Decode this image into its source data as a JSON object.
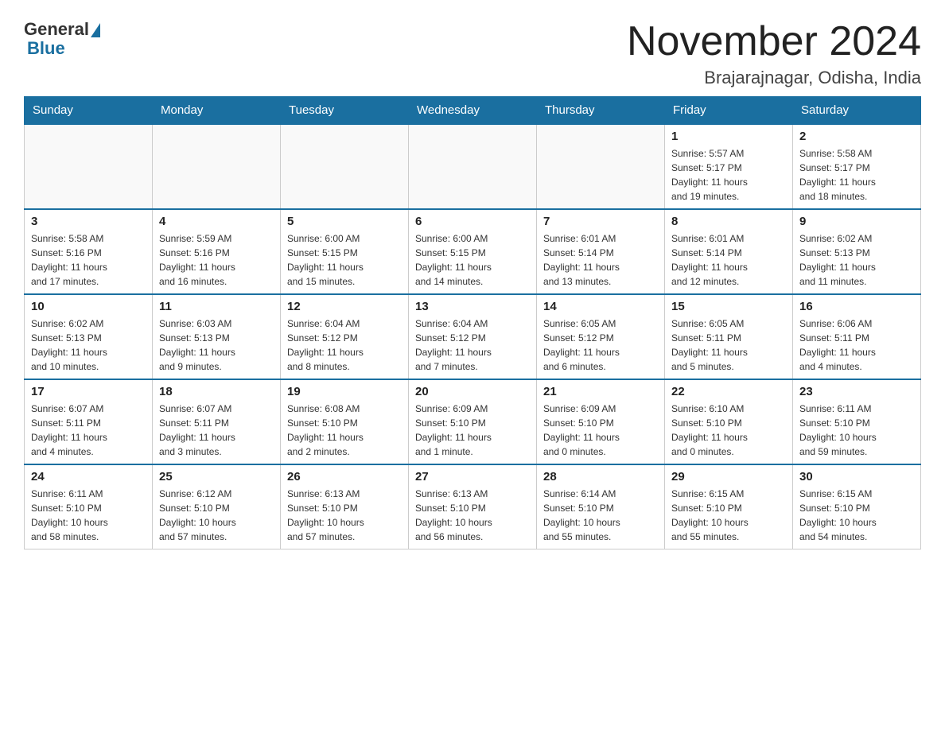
{
  "logo": {
    "general": "General",
    "blue": "Blue"
  },
  "title": "November 2024",
  "location": "Brajarajnagar, Odisha, India",
  "weekdays": [
    "Sunday",
    "Monday",
    "Tuesday",
    "Wednesday",
    "Thursday",
    "Friday",
    "Saturday"
  ],
  "weeks": [
    [
      {
        "day": "",
        "info": ""
      },
      {
        "day": "",
        "info": ""
      },
      {
        "day": "",
        "info": ""
      },
      {
        "day": "",
        "info": ""
      },
      {
        "day": "",
        "info": ""
      },
      {
        "day": "1",
        "info": "Sunrise: 5:57 AM\nSunset: 5:17 PM\nDaylight: 11 hours\nand 19 minutes."
      },
      {
        "day": "2",
        "info": "Sunrise: 5:58 AM\nSunset: 5:17 PM\nDaylight: 11 hours\nand 18 minutes."
      }
    ],
    [
      {
        "day": "3",
        "info": "Sunrise: 5:58 AM\nSunset: 5:16 PM\nDaylight: 11 hours\nand 17 minutes."
      },
      {
        "day": "4",
        "info": "Sunrise: 5:59 AM\nSunset: 5:16 PM\nDaylight: 11 hours\nand 16 minutes."
      },
      {
        "day": "5",
        "info": "Sunrise: 6:00 AM\nSunset: 5:15 PM\nDaylight: 11 hours\nand 15 minutes."
      },
      {
        "day": "6",
        "info": "Sunrise: 6:00 AM\nSunset: 5:15 PM\nDaylight: 11 hours\nand 14 minutes."
      },
      {
        "day": "7",
        "info": "Sunrise: 6:01 AM\nSunset: 5:14 PM\nDaylight: 11 hours\nand 13 minutes."
      },
      {
        "day": "8",
        "info": "Sunrise: 6:01 AM\nSunset: 5:14 PM\nDaylight: 11 hours\nand 12 minutes."
      },
      {
        "day": "9",
        "info": "Sunrise: 6:02 AM\nSunset: 5:13 PM\nDaylight: 11 hours\nand 11 minutes."
      }
    ],
    [
      {
        "day": "10",
        "info": "Sunrise: 6:02 AM\nSunset: 5:13 PM\nDaylight: 11 hours\nand 10 minutes."
      },
      {
        "day": "11",
        "info": "Sunrise: 6:03 AM\nSunset: 5:13 PM\nDaylight: 11 hours\nand 9 minutes."
      },
      {
        "day": "12",
        "info": "Sunrise: 6:04 AM\nSunset: 5:12 PM\nDaylight: 11 hours\nand 8 minutes."
      },
      {
        "day": "13",
        "info": "Sunrise: 6:04 AM\nSunset: 5:12 PM\nDaylight: 11 hours\nand 7 minutes."
      },
      {
        "day": "14",
        "info": "Sunrise: 6:05 AM\nSunset: 5:12 PM\nDaylight: 11 hours\nand 6 minutes."
      },
      {
        "day": "15",
        "info": "Sunrise: 6:05 AM\nSunset: 5:11 PM\nDaylight: 11 hours\nand 5 minutes."
      },
      {
        "day": "16",
        "info": "Sunrise: 6:06 AM\nSunset: 5:11 PM\nDaylight: 11 hours\nand 4 minutes."
      }
    ],
    [
      {
        "day": "17",
        "info": "Sunrise: 6:07 AM\nSunset: 5:11 PM\nDaylight: 11 hours\nand 4 minutes."
      },
      {
        "day": "18",
        "info": "Sunrise: 6:07 AM\nSunset: 5:11 PM\nDaylight: 11 hours\nand 3 minutes."
      },
      {
        "day": "19",
        "info": "Sunrise: 6:08 AM\nSunset: 5:10 PM\nDaylight: 11 hours\nand 2 minutes."
      },
      {
        "day": "20",
        "info": "Sunrise: 6:09 AM\nSunset: 5:10 PM\nDaylight: 11 hours\nand 1 minute."
      },
      {
        "day": "21",
        "info": "Sunrise: 6:09 AM\nSunset: 5:10 PM\nDaylight: 11 hours\nand 0 minutes."
      },
      {
        "day": "22",
        "info": "Sunrise: 6:10 AM\nSunset: 5:10 PM\nDaylight: 11 hours\nand 0 minutes."
      },
      {
        "day": "23",
        "info": "Sunrise: 6:11 AM\nSunset: 5:10 PM\nDaylight: 10 hours\nand 59 minutes."
      }
    ],
    [
      {
        "day": "24",
        "info": "Sunrise: 6:11 AM\nSunset: 5:10 PM\nDaylight: 10 hours\nand 58 minutes."
      },
      {
        "day": "25",
        "info": "Sunrise: 6:12 AM\nSunset: 5:10 PM\nDaylight: 10 hours\nand 57 minutes."
      },
      {
        "day": "26",
        "info": "Sunrise: 6:13 AM\nSunset: 5:10 PM\nDaylight: 10 hours\nand 57 minutes."
      },
      {
        "day": "27",
        "info": "Sunrise: 6:13 AM\nSunset: 5:10 PM\nDaylight: 10 hours\nand 56 minutes."
      },
      {
        "day": "28",
        "info": "Sunrise: 6:14 AM\nSunset: 5:10 PM\nDaylight: 10 hours\nand 55 minutes."
      },
      {
        "day": "29",
        "info": "Sunrise: 6:15 AM\nSunset: 5:10 PM\nDaylight: 10 hours\nand 55 minutes."
      },
      {
        "day": "30",
        "info": "Sunrise: 6:15 AM\nSunset: 5:10 PM\nDaylight: 10 hours\nand 54 minutes."
      }
    ]
  ]
}
